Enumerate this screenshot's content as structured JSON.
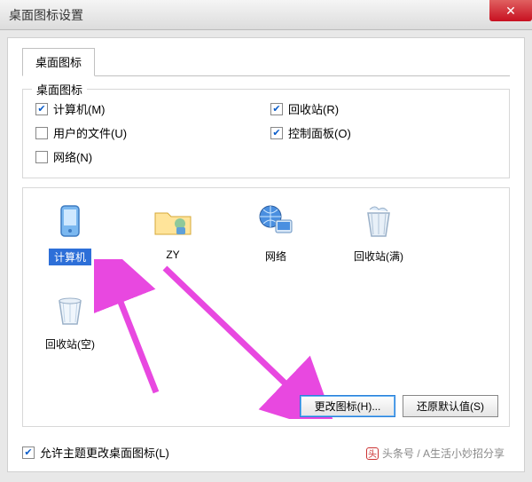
{
  "window": {
    "title": "桌面图标设置",
    "close_symbol": "✕"
  },
  "tab": {
    "label": "桌面图标"
  },
  "group": {
    "title": "桌面图标",
    "checkboxes": [
      {
        "label": "计算机(M)",
        "checked": true
      },
      {
        "label": "回收站(R)",
        "checked": true
      },
      {
        "label": "用户的文件(U)",
        "checked": false
      },
      {
        "label": "控制面板(O)",
        "checked": true
      },
      {
        "label": "网络(N)",
        "checked": false
      }
    ]
  },
  "icons": {
    "row1": [
      {
        "name": "计算机",
        "selected": true
      },
      {
        "name": "ZY",
        "selected": false
      },
      {
        "name": "网络",
        "selected": false
      },
      {
        "name": "回收站(满)",
        "selected": false
      }
    ],
    "row2": [
      {
        "name": "回收站(空)",
        "selected": false
      }
    ]
  },
  "buttons": {
    "change_icon": "更改图标(H)...",
    "restore_default": "还原默认值(S)"
  },
  "allow_themes": {
    "label": "允许主题更改桌面图标(L)",
    "checked": true
  },
  "watermark": "头条号 / A生活小妙招分享"
}
